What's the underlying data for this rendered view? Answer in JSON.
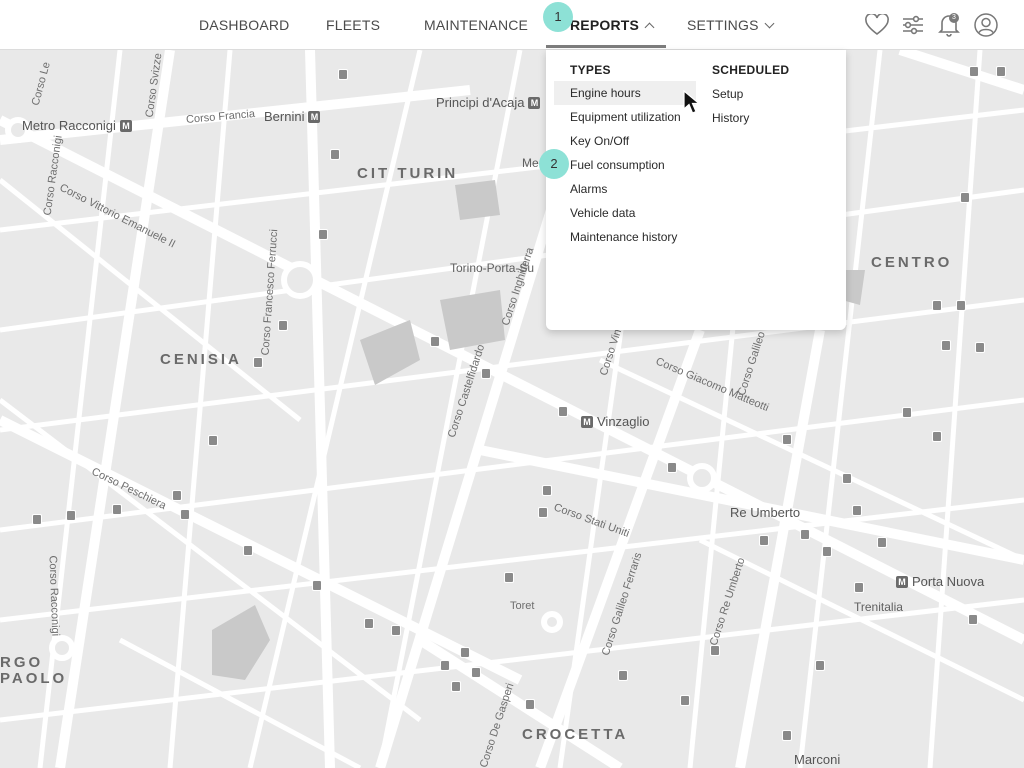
{
  "nav": {
    "items": [
      {
        "label": "DASHBOARD"
      },
      {
        "label": "FLEETS"
      },
      {
        "label": "MAINTENANCE"
      },
      {
        "label": "REPORTS"
      },
      {
        "label": "SETTINGS"
      }
    ],
    "active": "REPORTS",
    "icons": [
      "heart-icon",
      "filter-sliders-icon",
      "bell-icon",
      "user-avatar-icon"
    ],
    "notification_count": "3"
  },
  "dropdown": {
    "types_heading": "TYPES",
    "types": [
      {
        "label": "Engine hours"
      },
      {
        "label": "Equipment utilization"
      },
      {
        "label": "Key On/Off"
      },
      {
        "label": "Fuel consumption"
      },
      {
        "label": "Alarms"
      },
      {
        "label": "Vehicle data"
      },
      {
        "label": "Maintenance history"
      }
    ],
    "highlighted": "Engine hours",
    "scheduled_heading": "SCHEDULED",
    "scheduled": [
      {
        "label": "Setup"
      },
      {
        "label": "History"
      }
    ]
  },
  "annotations": {
    "marker1": "1",
    "marker2": "2"
  },
  "map": {
    "districts": {
      "cit_turin": "CIT TURIN",
      "cenisia": "CENISIA",
      "centro": "CENTRO",
      "crocetta": "CROCETTA",
      "borgo_san_paolo": "RGO\nPAOLO"
    },
    "metro": {
      "racconigi": "Metro Racconigi",
      "bernini": "Bernini",
      "principi_acaja": "Principi d'Acaja",
      "vinzaglio": "Vinzaglio",
      "re_umberto": "Re Umberto",
      "porta_nuova": "Porta Nuova",
      "marconi": "Marconi"
    },
    "places": {
      "porta_susa": "Torino-Porta-Su",
      "trenitalia": "Trenitalia",
      "toret": "Toret",
      "me_partial": "Me"
    },
    "streets": {
      "corso_francia": "Corso Francia",
      "vittorio_emanuele": "Corso Vittorio Emanuele II",
      "corso_racconigi": "Corso Racconigi",
      "corso_racconigi_2": "Corso Racconigi",
      "corso_ferrucci": "Corso Francesco Ferrucci",
      "corso_peschiera": "Corso Peschiera",
      "corso_castelfidardo": "Corso Castelfidardo",
      "corso_inghilterra": "Corso Inghilterra",
      "corso_vinzaglio": "Corso Vinzaglio",
      "corso_matteotti": "Corso Giacomo Matteotti",
      "corso_galileo_ferraris_n": "Corso Galileo Fe",
      "corso_stati_uniti": "Corso Stati Uniti",
      "corso_galileo_ferraris": "Corso Galileo Ferraris",
      "corso_re_umberto": "Corso Re Umberto",
      "de_gasperi": "Corso De Gasperi",
      "corso_le": "Corso Le",
      "corso_svizzera": "Corso Svizze"
    }
  }
}
